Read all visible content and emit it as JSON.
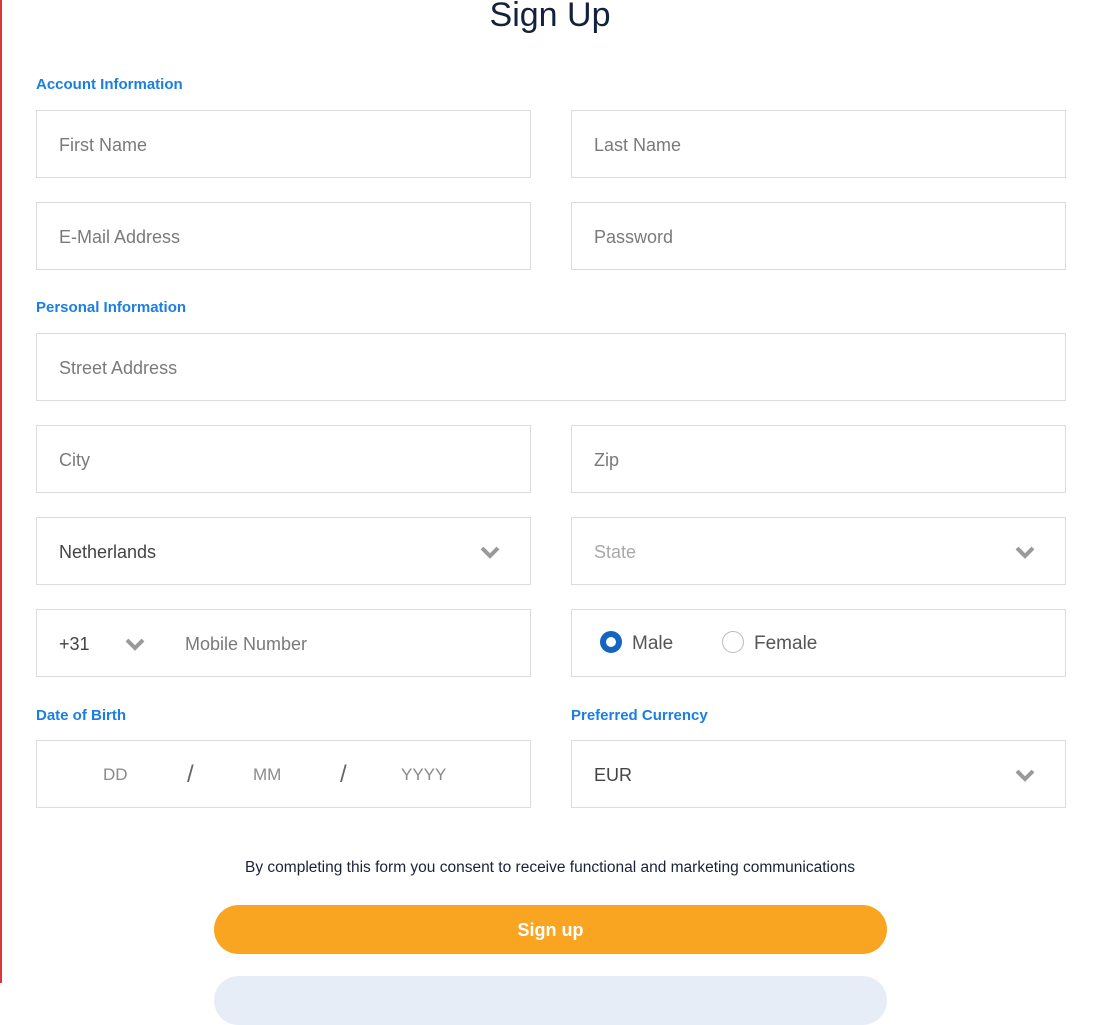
{
  "title": "Sign Up",
  "sections": {
    "account": "Account Information",
    "personal": "Personal Information",
    "dob": "Date of Birth",
    "currency": "Preferred Currency"
  },
  "fields": {
    "first_name": "First Name",
    "last_name": "Last Name",
    "email": "E-Mail Address",
    "password": "Password",
    "street": "Street Address",
    "city": "City",
    "zip": "Zip",
    "country": "Netherlands",
    "state": "State",
    "dial_code": "+31",
    "mobile": "Mobile Number",
    "dob_day": "DD",
    "dob_month": "MM",
    "dob_year": "YYYY",
    "dob_sep": "/",
    "currency": "EUR"
  },
  "gender": {
    "options": [
      "Male",
      "Female"
    ],
    "selected": "Male"
  },
  "consent": "By completing this form you consent to receive functional and marketing communications",
  "signup_label": "Sign up",
  "colors": {
    "accent": "#1a7fe0",
    "button": "#f9a521",
    "radio": "#1565c0",
    "border_left": "#d9363e"
  }
}
